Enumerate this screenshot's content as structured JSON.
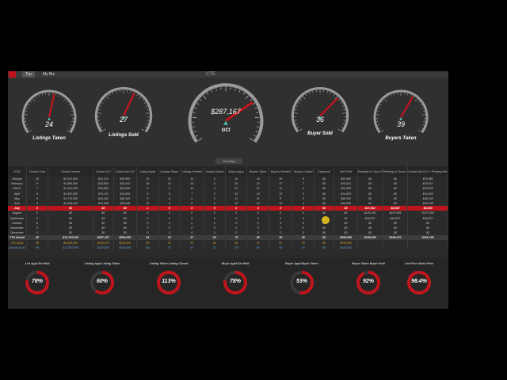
{
  "window": {
    "title": "CTE",
    "tabs": [
      "Top",
      "My Biz"
    ]
  },
  "status": {
    "pending": "Pending"
  },
  "gauges": [
    {
      "value": "24",
      "label": "Listings Taken",
      "fraction": 0.55
    },
    {
      "value": "27",
      "label": "Listings Sold",
      "fraction": 0.6
    },
    {
      "value": "$287,167",
      "label": "GCI",
      "fraction": 0.72
    },
    {
      "value": "36",
      "label": "Buyer Sold",
      "fraction": 0.68
    },
    {
      "value": "39",
      "label": "Buyers Taken",
      "fraction": 0.62
    }
  ],
  "table": {
    "year": "2019",
    "headers": [
      "Closed Units",
      "Closed Volume",
      "Closed GCI",
      "Closed Net GCI",
      "Listing Appts",
      "Listings Taken",
      "Listings Pended",
      "Listing Closed",
      "Buyer Appts",
      "Buyers Taken",
      "Buyers Pended",
      "Buyers Closed",
      "Expenses",
      "Net Profit",
      "Pending to Close GCI",
      "Pending to Close Net GCI",
      "Closed Net GCI + Pending Net GCI"
    ],
    "rows": [
      {
        "m": "January",
        "v": [
          "10",
          "$3,121,000",
          "$31,214",
          "$30,982",
          "13",
          "10",
          "11",
          "4",
          "16",
          "14",
          "16",
          "6",
          "$0",
          "$30,982",
          "$0",
          "$0",
          "$30,982"
        ]
      },
      {
        "m": "February",
        "v": [
          "8",
          "$1,984,000",
          "$19,852",
          "$19,612",
          "15",
          "11",
          "14",
          "5",
          "20",
          "13",
          "17",
          "7",
          "$0",
          "$19,612",
          "$0",
          "$0",
          "$19,612"
        ]
      },
      {
        "m": "March",
        "v": [
          "7",
          "$1,351,000",
          "$28,800",
          "$25,506",
          "8",
          "6",
          "10",
          "3",
          "12",
          "12",
          "11",
          "4",
          "$0",
          "$25,506",
          "$0",
          "$0",
          "$25,506"
        ]
      },
      {
        "m": "April",
        "v": [
          "9",
          "$1,502,000",
          "$15,221",
          "$14,926",
          "8",
          "5",
          "7",
          "3",
          "16",
          "14",
          "12",
          "6",
          "$0",
          "$14,926",
          "$0",
          "$0",
          "$14,926"
        ]
      },
      {
        "m": "May",
        "v": [
          "6",
          "$1,175,000",
          "$49,342",
          "$48,342",
          "9",
          "4",
          "6",
          "3",
          "11",
          "11",
          "8",
          "3",
          "$0",
          "$48,342",
          "$0",
          "$0",
          "$48,342"
        ]
      },
      {
        "m": "June",
        "v": [
          "8",
          "$1,284,000",
          "$31,548",
          "$30,548",
          "10",
          "4",
          "6",
          "3",
          "14",
          "14",
          "10",
          "4",
          "$0",
          "$30,548",
          "$0",
          "$0",
          "$30,548"
        ]
      },
      {
        "m": "July",
        "v": [
          "0",
          "$0",
          "$0",
          "$0",
          "1",
          "0",
          "0",
          "0",
          "0",
          "0",
          "0",
          "0",
          "$0",
          "$0",
          "$17,832",
          "$8,665",
          "$8,665"
        ]
      },
      {
        "m": "August",
        "v": [
          "0",
          "$0",
          "$0",
          "$0",
          "0",
          "0",
          "0",
          "0",
          "0",
          "0",
          "0",
          "0",
          "$0",
          "$0",
          "$120,292",
          "$107,066",
          "$107,066"
        ]
      },
      {
        "m": "September",
        "v": [
          "0",
          "$0",
          "$0",
          "$0",
          "0",
          "0",
          "0",
          "0",
          "0",
          "0",
          "0",
          "0",
          "$0",
          "$0",
          "$44,837",
          "$44,837",
          "$44,837"
        ]
      },
      {
        "m": "October",
        "v": [
          "0",
          "$0",
          "$0",
          "$0",
          "0",
          "0",
          "0",
          "0",
          "0",
          "0",
          "0",
          "0",
          "$0",
          "$0",
          "$0",
          "$0",
          "$0"
        ]
      },
      {
        "m": "November",
        "v": [
          "0",
          "$0",
          "$0",
          "$0",
          "0",
          "0",
          "0",
          "0",
          "0",
          "0",
          "0",
          "0",
          "$0",
          "$0",
          "$0",
          "$0",
          "$0"
        ]
      },
      {
        "m": "December",
        "v": [
          "0",
          "$0",
          "$0",
          "$0",
          "0",
          "0",
          "0",
          "0",
          "0",
          "0",
          "0",
          "0",
          "$0",
          "$0",
          "$0",
          "$0",
          "$0"
        ]
      }
    ],
    "ytd_actual": {
      "m": "YTD Actual",
      "v": [
        "48",
        "$12,702,036",
        "$287,167",
        "$266,096",
        "64",
        "24",
        "27",
        "24",
        "75",
        "39",
        "36",
        "36",
        "$0",
        "$266,096",
        "$186,630",
        "$166,470",
        "$431,156"
      ]
    },
    "ytd_goal": {
      "m": "YTD Goal",
      "v": [
        "38",
        "$9,434,000",
        "$244,575",
        "$234,900",
        "83",
        "20",
        "29",
        "18",
        "96",
        "47",
        "31",
        "32",
        "$0",
        "$234,900",
        "",
        ""
      ]
    },
    "annual_goal": {
      "m": "Annual Goal",
      "v": [
        "69",
        "$17,000,000",
        "$432,000",
        "$416,000",
        "146",
        "37",
        "47",
        "32",
        "170",
        "84",
        "58",
        "57",
        "$0",
        "$416,000",
        "",
        ""
      ]
    }
  },
  "kpis": [
    {
      "label": "List Appt Set  Held",
      "value": "78%",
      "fraction": 0.78
    },
    {
      "label": "Listing Appt  Listing Taken",
      "value": "60%",
      "fraction": 0.6
    },
    {
      "label": "Listing Taken  Listing Closed",
      "value": "113%",
      "fraction": 1.0
    },
    {
      "label": "Buyer Appt Set  Held",
      "value": "78%",
      "fraction": 0.78
    },
    {
      "label": "Buyer Appt  Buyer Taken",
      "value": "53%",
      "fraction": 0.53
    },
    {
      "label": "Buyer Taken  Buyer Sold",
      "value": "92%",
      "fraction": 0.92
    },
    {
      "label": "List Price  Sales Price",
      "value": "98.4%",
      "fraction": 0.984
    }
  ],
  "colors": {
    "accent": "#c0141c",
    "panel": "#2a2a2a",
    "goal": "#d9a32a"
  }
}
